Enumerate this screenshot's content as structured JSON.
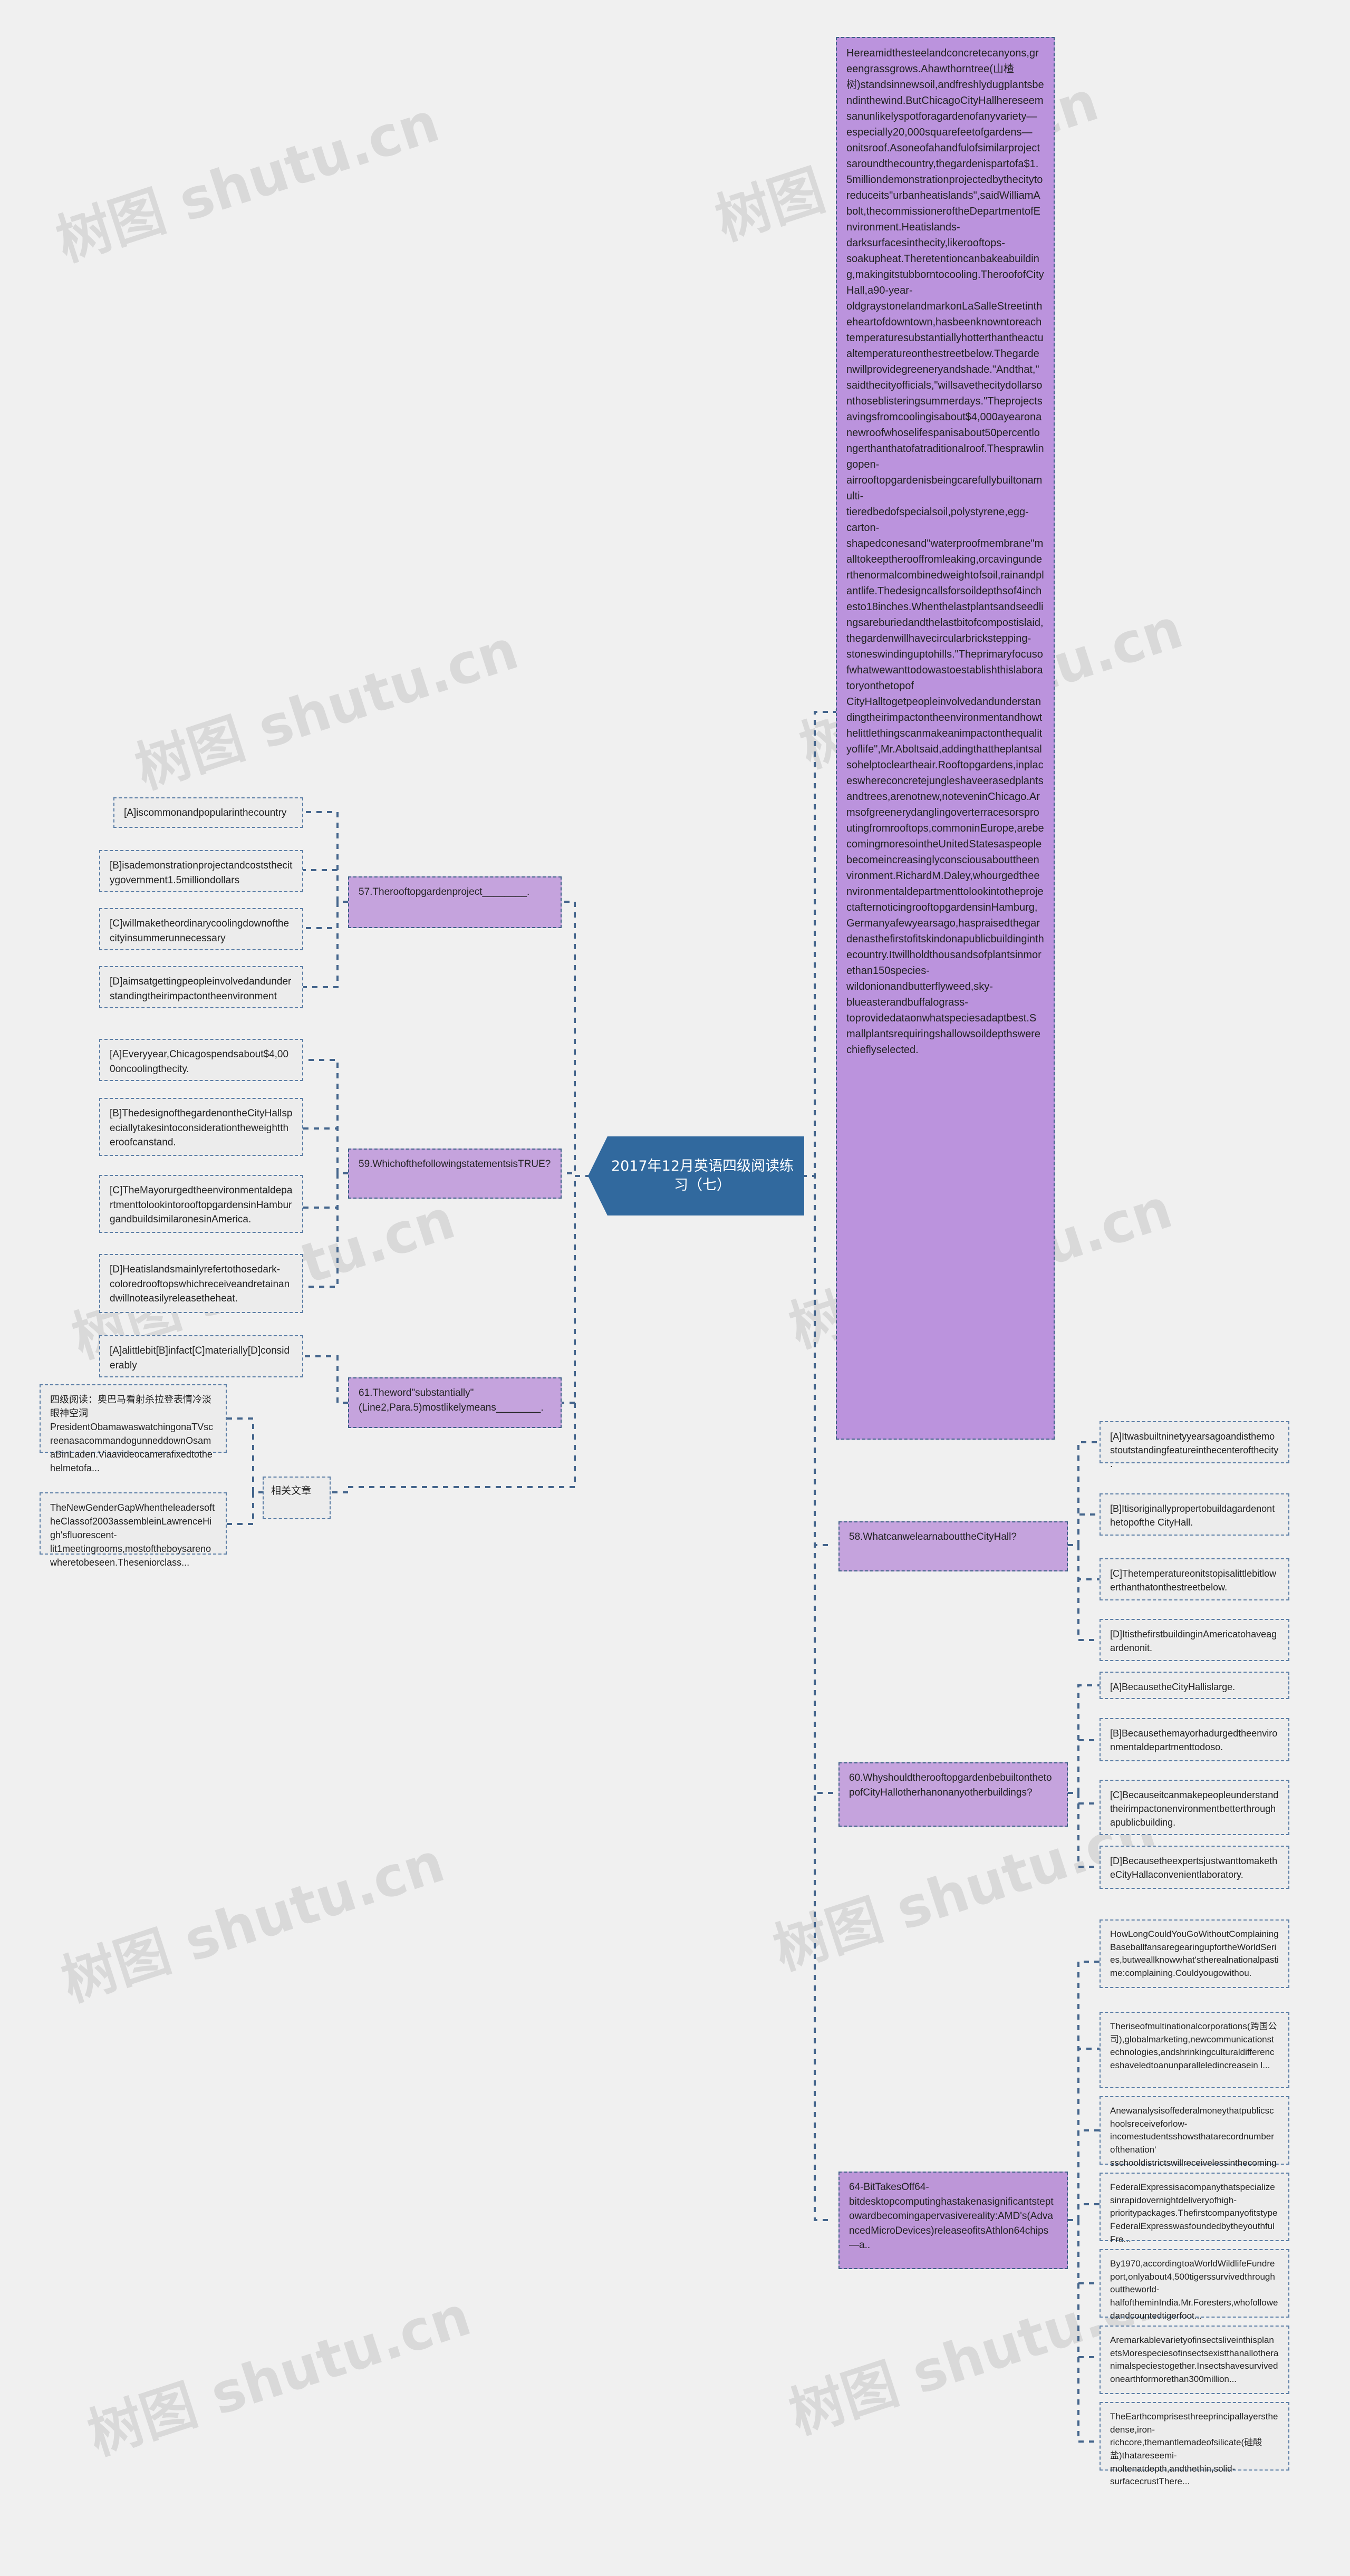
{
  "meta": {
    "watermarks": [
      "树图 shutu.cn",
      "树图 shutu.cn",
      "树图 shutu.cn",
      "树图 shutu.cn",
      "树图 shutu.cn",
      "树图 shutu.cn"
    ],
    "colors": {
      "center_node": "#31699e",
      "passage_node": "#bb93dd",
      "question_node": "#c5a3dd",
      "option_node": "#ececec",
      "border": "#44658c",
      "canvas": "#f0f0f0"
    }
  },
  "center": {
    "title": "2017年12月英语四级阅读练习（七）"
  },
  "passage": {
    "text": "Hereamidthesteelandconcretecanyons,greengrassgrows.Ahawthorntree(山楂树)standsinnewsoil,andfreshlydugplantsbendinthewind.ButChicagoCityHallhereseemsanunlikelyspotforagardenofanyvariety—especially20,000squarefeetofgardens—onitsroof.Asoneofahandfulofsimilarprojectsaroundthecountry,thegardenispartofa$1.5milliondemonstrationprojectedbythecitytoreduceits\"urbanheatislands\",saidWilliamAbolt,thecommissioneroftheDepartmentofEnvironment.Heatislands-darksurfacesinthecity,likerooftops-soakupheat.Theretentioncanbakeabuilding,makingitstubborntocooling.TheroofofCityHall,a90-year-oldgraystonelandmarkonLaSalleStreetintheheartofdowntown,hasbeenknowntoreachtemperaturesubstantiallyhotterthantheactualtemperatureonthestreetbelow.Thegardenwillprovidegreeneryandshade.\"Andthat,\"saidthecityofficials,\"willsavethecitydollarsonthoseblisteringsummerdays.\"Theprojectsavingsfromcoolingisabout$4,000ayearonanewroofwhoselifespanisabout50percentlongerthanthatofatraditionalroof.Thesprawlingopen-airrooftopgardenisbeingcarefullybuiltonamulti-tieredbedofspecialsoil,polystyrene,egg-carton-shapedconesand\"waterproofmembrane\"malltokeeptherooffromleaking,orcavingunderthenormalcombinedweightofsoil,rainandplantlife.Thedesigncallsforsoildepthsof4inchesto18inches.Whenthelastplantsandseedlingsareburiedandthelastbitofcompostislaid,thegardenwillhavecircularbrickstepping-stoneswindinguptohills.\"Theprimaryfocusofwhatwewanttodowastoestablishthislaboratoryonthetopof CityHalltogetpeopleinvolvedandunderstandingtheirimpactontheenvironmentandhowthelittlethingscanmakeanimpactonthequalityoflife\",Mr.Aboltsaid,addingthattheplantsalsohelptocleartheair.Rooftopgardens,inplaceswhereconcretejungleshaveerasedplantsandtrees,arenotnew,noteveninChicago.Armsofgreenerydanglingoverterracesorsproutingfromrooftops,commoninEurope,arebecomingmoresointheUnitedStatesaspeoplebecomeincreasinglyconsciousabouttheenvironment.RichardM.Daley,whourgedtheenvironmentaldepartmenttolookintotheprojectafternoticingrooftopgardensinHamburg,Germanyafewyearsago,haspraisedthegardenasthefirstofitskindonapublicbuildinginthecountry.Itwillholdthousandsofplantsinmorethan150species-wildonionandbutterflyweed,sky-blueasterandbuffalograss-toprovidedataonwhatspeciesadaptbest.Smallplantsrequiringshallowsoildepthswerechieflyselected."
  },
  "questions": [
    {
      "id": "q57",
      "text": "57.Therooftopgardenproject________.",
      "options": [
        "[A]iscommonandpopularinthecountry",
        "[B]isademonstrationprojectandcoststhecitygovernment1.5milliondollars",
        "[C]willmaketheordinarycoolingdownofthecityinsummerunnecessary",
        "[D]aimsatgettingpeopleinvolvedandunderstandingtheirimpactontheenvironment"
      ]
    },
    {
      "id": "q59",
      "text": "59.WhichofthefollowingstatementsisTRUE?",
      "options": [
        "[A]Everyyear,Chicagospendsabout$4,000oncoolingthecity.",
        "[B]ThedesignofthegardenontheCityHallspeciallytakesintoconsiderationtheweighttheroofcanstand.",
        "[C]TheMayorurgedtheenvironmentaldepartmenttolookintorooftopgardensinHamburgandbuildsimilaronesinAmerica.",
        "[D]Heatislandsmainlyrefertothosedark-coloredrooftopswhichreceiveandretainandwillnoteasilyreleasetheheat."
      ]
    },
    {
      "id": "q61",
      "text": "61.Theword\"substantially\"(Line2,Para.5)mostlikelymeans________.",
      "options": [
        "[A]alittlebit[B]infact[C]materially[D]considerably"
      ]
    },
    {
      "id": "q58",
      "text": "58.WhatcanwelearnabouttheCityHall?",
      "options": [
        "[A]Itwasbuiltninetyyearsagoandisthemostoutstandingfeatureinthecenterofthecity.",
        "[B]Itisoriginallypropertobuildagardenonthetopofthe CityHall.",
        "[C]Thetemperatureonitstopisalittlebitlowerthanthatonthestreetbelow.",
        "[D]ItisthefirstbuildinginAmericatohaveagardenonit."
      ]
    },
    {
      "id": "q60",
      "text": "60.WhyshouldtherooftopgardenbebuiltonthetopofCityHallotherhanonanyotherbuildings?",
      "options": [
        "[A]BecausetheCityHallislarge.",
        "[B]Becausethemayorhadurgedtheenvironmentaldepartmenttodoso.",
        "[C]Becauseitcanmakepeopleunderstandtheirimpactonenvironmentbetterthroughapublicbuilding.",
        "[D]BecausetheexpertsjustwanttomaketheCityHallaconvenientlaboratory."
      ]
    }
  ],
  "related_label": "相关文章",
  "left_related": [
    "四级阅读：奥巴马看射杀拉登表情冷淡眼神空洞PresidentObamawaswatchingonaTVscreenasacommandogunneddownOsamaBinLaden.Viaavideocamerafixedtothehelmetofa...",
    "TheNewGenderGapWhentheleadersoftheClassof2003assembleinLawrenceHigh'sfluorescent-lit1meetingrooms,mostoftheboysarenowheretobeseen.Theseniorclass..."
  ],
  "bottom_node": {
    "text": "64-BitTakesOff64-bitdesktopcomputinghastakenasignificantsteptowardbecomingapervasivereality:AMD's(AdvancedMicroDevices)releaseofitsAthlon64chips—a.."
  },
  "right_related": [
    "HowLongCouldYouGoWithoutComplainingBaseballfansaregearingupfortheWorldSeries,butweallknowwhat'stherealnationalpastime:complaining.Couldyougowithou.",
    "Theriseofmultinationalcorporations(跨国公司),globalmarketing,newcommunicationstechnologies,andshrinkingculturaldifferenceshaveledtoanunparalleledincreasein l...",
    "Anewanalysisoffederalmoneythatpublicschoolsreceiveforlow-incomestudentsshowsthatarecordnumberofthenation'  sschooldistrictswillreceivelessinthecomingac...",
    "FederalExpressisacompanythatspecializesinrapidovernightdeliveryofhigh-prioritypackages.ThefirstcompanyofitstypeFederalExpresswasfoundedbytheyouthfulFre...",
    "By1970,accordingtoaWorldWildlifeFundreport,onlyabout4,500tigerssurvivedthroughouttheworld-halfoftheminIndia.Mr.Foresters,whofollowedandcountedtigerfoot...",
    "AremarkablevarietyofinsectsliveinthisplanetsMorespeciesofinsectsexistthanallotheranimalspeciestogether.Insectshavesurvivedonearthformorethan300million...",
    "TheEarthcomprisesthreeprincipallayersthedense,iron-richcore,themantlemadeofsilicate(硅酸盐)thatareseemi-moltenatdepth,andthethin,solid-surfacecrustThere..."
  ]
}
